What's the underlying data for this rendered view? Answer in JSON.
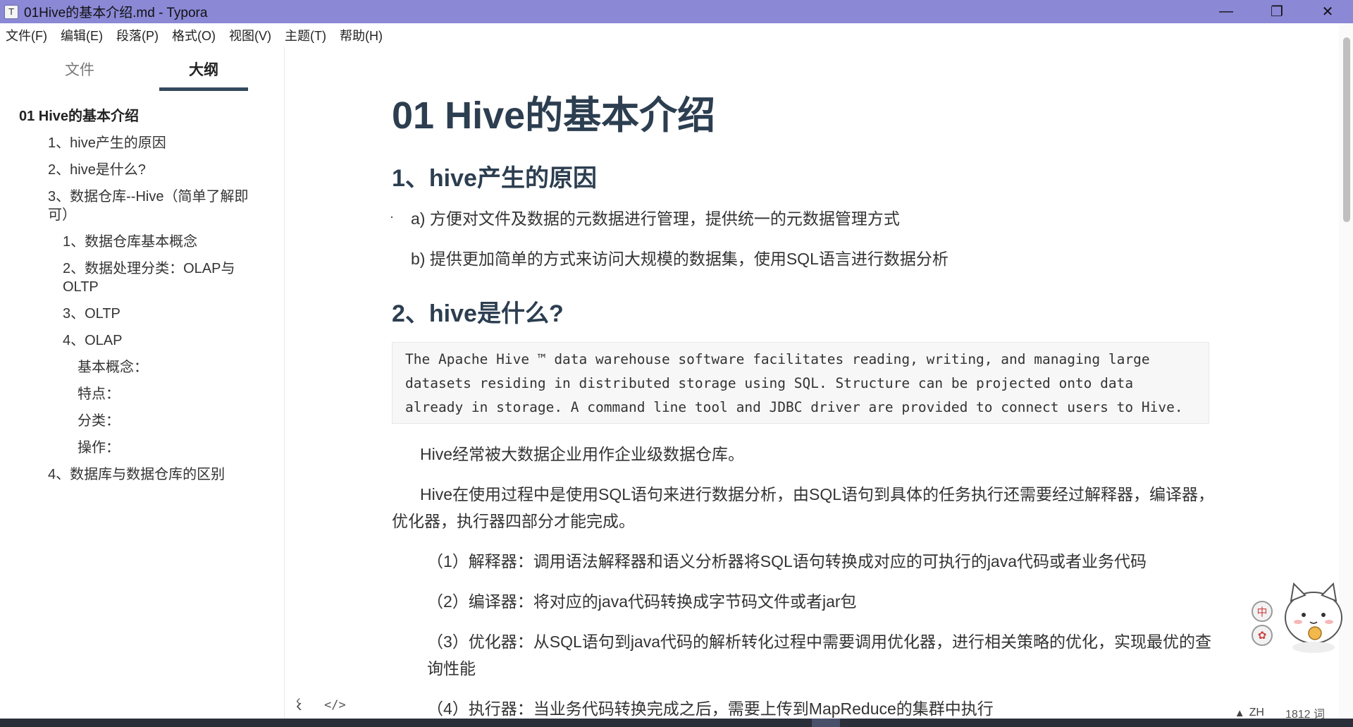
{
  "window": {
    "title": "01Hive的基本介绍.md - Typora",
    "icon_letter": "T",
    "minimize_glyph": "—",
    "restore_glyph": "❐",
    "close_glyph": "✕"
  },
  "menubar": {
    "items": [
      "文件(F)",
      "编辑(E)",
      "段落(P)",
      "格式(O)",
      "视图(V)",
      "主题(T)",
      "帮助(H)"
    ]
  },
  "sidebar": {
    "tab_files": "文件",
    "tab_outline": "大纲",
    "active_tab": "大纲",
    "outline": [
      {
        "level": 1,
        "text": "01 Hive的基本介绍"
      },
      {
        "level": 2,
        "text": "1、hive产生的原因"
      },
      {
        "level": 2,
        "text": "2、hive是什么?"
      },
      {
        "level": 2,
        "text": "3、数据仓库--Hive（简单了解即可）"
      },
      {
        "level": 3,
        "text": "1、数据仓库基本概念"
      },
      {
        "level": 3,
        "text": "2、数据处理分类：OLAP与OLTP"
      },
      {
        "level": 3,
        "text": "3、OLTP"
      },
      {
        "level": 3,
        "text": "4、OLAP"
      },
      {
        "level": 4,
        "text": "基本概念："
      },
      {
        "level": 4,
        "text": "特点："
      },
      {
        "level": 4,
        "text": "分类："
      },
      {
        "level": 4,
        "text": "操作："
      },
      {
        "level": 2,
        "text": "4、数据库与数据仓库的区别"
      }
    ],
    "footer_back_glyph": "‹",
    "footer_source_glyph": "</>"
  },
  "document": {
    "h1": "01 Hive的基本介绍",
    "sec1_title": "1、hive产生的原因",
    "sec1_item_a": "a) 方便对文件及数据的元数据进行管理，提供统一的元数据管理方式",
    "sec1_item_b": "b) 提供更加简单的方式来访问大规模的数据集，使用SQL语言进行数据分析",
    "sec2_title": "2、hive是什么?",
    "code_block": "The Apache Hive ™ data warehouse software facilitates reading, writing, and managing large\ndatasets residing in distributed storage using SQL. Structure can be projected onto data\nalready in storage. A command line tool and JDBC driver are provided to connect users to Hive.",
    "para1": "Hive经常被大数据企业用作企业级数据仓库。",
    "para2": "Hive在使用过程中是使用SQL语句来进行数据分析，由SQL语句到具体的任务执行还需要经过解释器，编译器，优化器，执行器四部分才能完成。",
    "step1": "（1）解释器：调用语法解释器和语义分析器将SQL语句转换成对应的可执行的java代码或者业务代码",
    "step2": "（2）编译器：将对应的java代码转换成字节码文件或者jar包",
    "step3": "（3）优化器：从SQL语句到java代码的解析转化过程中需要调用优化器，进行相关策略的优化，实现最优的查询性能",
    "step4": "（4）执行器：当业务代码转换完成之后，需要上传到MapReduce的集群中执行"
  },
  "statusbar": {
    "warning_glyph": "▲",
    "language": "ZH",
    "word_count": "1812 词"
  },
  "widget": {
    "chip_top": "中",
    "chip_bottom": "✿"
  },
  "colors": {
    "titlebar": "#8b88d6",
    "heading": "#2c3e50",
    "tab_underline": "#34495e"
  }
}
